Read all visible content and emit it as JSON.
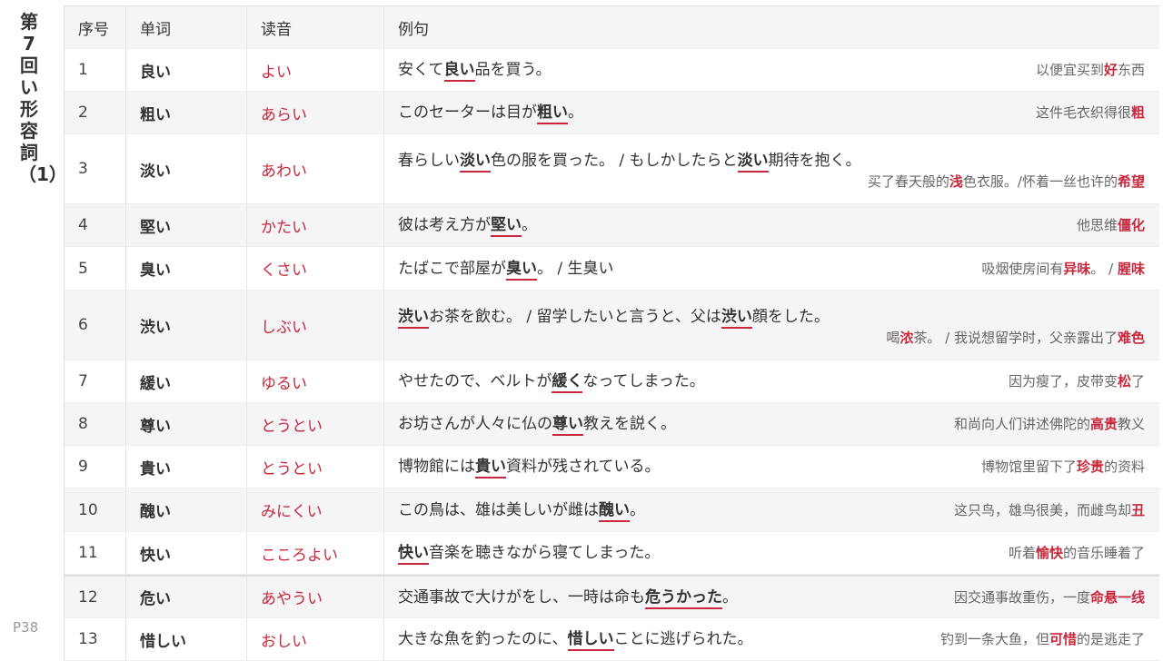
{
  "sidebar": {
    "title": "第7回い形容詞（1）",
    "page": "P38"
  },
  "header": {
    "no": "序号",
    "word": "单词",
    "reading": "读音",
    "example": "例句"
  },
  "colors": {
    "accent": "#c8283c"
  },
  "rows": [
    {
      "no": "1",
      "word": "良い",
      "reading": "よい",
      "jp": [
        {
          "t": "安くて"
        },
        {
          "t": "良い",
          "u": true
        },
        {
          "t": "品を買う。"
        }
      ],
      "cn": [
        {
          "t": "以便宜买到"
        },
        {
          "t": "好",
          "r": true
        },
        {
          "t": "东西"
        }
      ]
    },
    {
      "no": "2",
      "word": "粗い",
      "reading": "あらい",
      "jp": [
        {
          "t": "このセーターは目が"
        },
        {
          "t": "粗い",
          "u": true
        },
        {
          "t": "。"
        }
      ],
      "cn": [
        {
          "t": "这件毛衣织得很"
        },
        {
          "t": "粗",
          "r": true
        }
      ]
    },
    {
      "no": "3",
      "word": "淡い",
      "reading": "あわい",
      "jp": [
        {
          "t": "春らしい"
        },
        {
          "t": "淡い",
          "u": true
        },
        {
          "t": "色の服を買った。 / もしかしたらと"
        },
        {
          "t": "淡い",
          "u": true
        },
        {
          "t": "期待を抱く。"
        }
      ],
      "cn": [
        {
          "t": "买了春天般的"
        },
        {
          "t": "浅",
          "r": true
        },
        {
          "t": "色衣服。/怀着一丝也许的"
        },
        {
          "t": "希望",
          "r": true
        }
      ]
    },
    {
      "no": "4",
      "word": "堅い",
      "reading": "かたい",
      "jp": [
        {
          "t": "彼は考え方が"
        },
        {
          "t": "堅い",
          "u": true
        },
        {
          "t": "。"
        }
      ],
      "cn": [
        {
          "t": "他思维"
        },
        {
          "t": "僵化",
          "r": true
        }
      ]
    },
    {
      "no": "5",
      "word": "臭い",
      "reading": "くさい",
      "jp": [
        {
          "t": "たばこで部屋が"
        },
        {
          "t": "臭い",
          "u": true
        },
        {
          "t": "。 / 生臭い"
        }
      ],
      "cn": [
        {
          "t": "吸烟使房间有"
        },
        {
          "t": "异味",
          "r": true
        },
        {
          "t": "。 / "
        },
        {
          "t": "腥味",
          "r": true
        }
      ]
    },
    {
      "no": "6",
      "word": "渋い",
      "reading": "しぶい",
      "jp": [
        {
          "t": "渋い",
          "u": true
        },
        {
          "t": "お茶を飲む。 / 留学したいと言うと、父は"
        },
        {
          "t": "渋い",
          "u": true
        },
        {
          "t": "顔をした。"
        }
      ],
      "cn": [
        {
          "t": "喝"
        },
        {
          "t": "浓",
          "r": true
        },
        {
          "t": "茶。 / 我说想留学时，父亲露出了"
        },
        {
          "t": "难色",
          "r": true
        }
      ]
    },
    {
      "no": "7",
      "word": "緩い",
      "reading": "ゆるい",
      "jp": [
        {
          "t": "やせたので、ベルトが"
        },
        {
          "t": "緩く",
          "u": true
        },
        {
          "t": "なってしまった。"
        }
      ],
      "cn": [
        {
          "t": "因为瘦了，皮带变"
        },
        {
          "t": "松",
          "r": true
        },
        {
          "t": "了"
        }
      ]
    },
    {
      "no": "8",
      "word": "尊い",
      "reading": "とうとい",
      "jp": [
        {
          "t": "お坊さんが人々に仏の"
        },
        {
          "t": "尊い",
          "u": true
        },
        {
          "t": "教えを説く。"
        }
      ],
      "cn": [
        {
          "t": "和尚向人们讲述佛陀的"
        },
        {
          "t": "高贵",
          "r": true
        },
        {
          "t": "教义"
        }
      ]
    },
    {
      "no": "9",
      "word": "貴い",
      "reading": "とうとい",
      "jp": [
        {
          "t": "博物館には"
        },
        {
          "t": "貴い",
          "u": true
        },
        {
          "t": "資料が残されている。"
        }
      ],
      "cn": [
        {
          "t": "博物馆里留下了"
        },
        {
          "t": "珍贵",
          "r": true
        },
        {
          "t": "的资料"
        }
      ]
    },
    {
      "no": "10",
      "word": "醜い",
      "reading": "みにくい",
      "jp": [
        {
          "t": "この鳥は、雄は美しいが雌は"
        },
        {
          "t": "醜い",
          "u": true
        },
        {
          "t": "。"
        }
      ],
      "cn": [
        {
          "t": "这只鸟，雄鸟很美，而雌鸟却"
        },
        {
          "t": "丑",
          "r": true
        }
      ]
    },
    {
      "no": "11",
      "word": "快い",
      "reading": "こころよい",
      "jp": [
        {
          "t": "快い",
          "u": true
        },
        {
          "t": "音楽を聴きながら寝てしまった。"
        }
      ],
      "cn": [
        {
          "t": "听着"
        },
        {
          "t": "愉快",
          "r": true
        },
        {
          "t": "的音乐睡着了"
        }
      ]
    },
    {
      "no": "12",
      "word": "危い",
      "reading": "あやうい",
      "jp": [
        {
          "t": "交通事故で大けがをし、一時は命も"
        },
        {
          "t": "危うかった",
          "u": true
        },
        {
          "t": "。"
        }
      ],
      "cn": [
        {
          "t": "因交通事故重伤，一度"
        },
        {
          "t": "命悬一线",
          "r": true
        }
      ]
    },
    {
      "no": "13",
      "word": "惜しい",
      "reading": "おしい",
      "jp": [
        {
          "t": "大きな魚を釣ったのに、"
        },
        {
          "t": "惜しい",
          "u": true
        },
        {
          "t": "ことに逃げられた。"
        }
      ],
      "cn": [
        {
          "t": "钓到一条大鱼，但"
        },
        {
          "t": "可惜",
          "r": true
        },
        {
          "t": "的是逃走了"
        }
      ]
    }
  ]
}
